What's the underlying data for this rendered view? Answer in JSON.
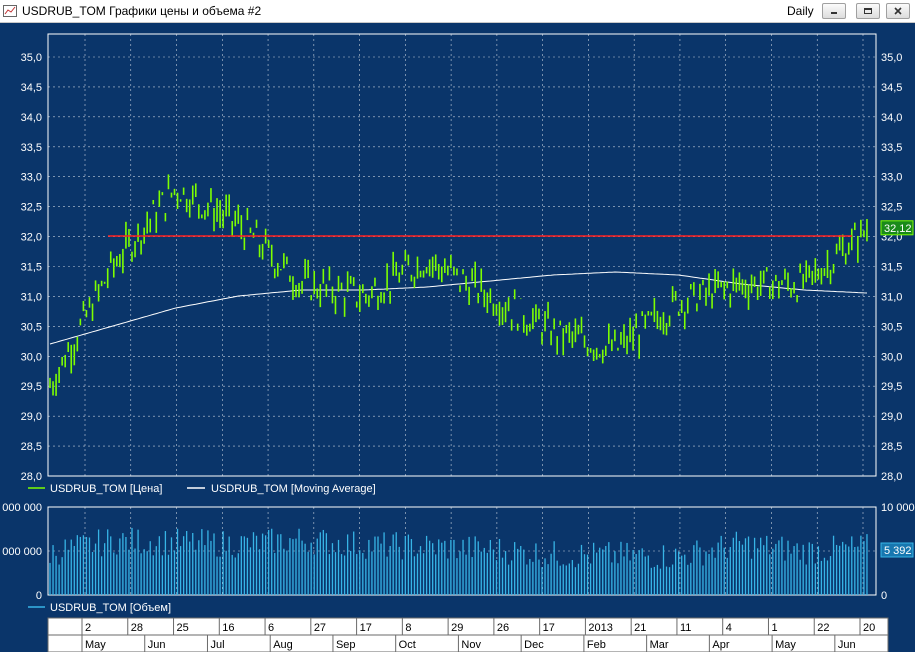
{
  "window": {
    "title": "USDRUB_TOM Графики цены и объема #2",
    "interval": "Daily",
    "icon": "chart-window-icon",
    "buttons": [
      "minimize-icon",
      "restore-icon",
      "close-icon"
    ]
  },
  "colors": {
    "background": "#0a356a",
    "price": "#7dff00",
    "moving_average": "#ffffff",
    "level_line": "#ff2020",
    "volume": "#37b4e6",
    "price_badge": "#1a8a1a",
    "volume_badge": "#1777b0"
  },
  "price_panel": {
    "y_ticks": [
      "35,0",
      "34,5",
      "34,0",
      "33,5",
      "33,0",
      "32,5",
      "32,0",
      "31,5",
      "31,0",
      "30,5",
      "30,0",
      "29,5",
      "29,0",
      "28,5",
      "28,0"
    ],
    "last_price": "32,12",
    "level": 32.0,
    "legend": [
      {
        "label": "USDRUB_TOM [Цена]",
        "icon": "green-line-icon"
      },
      {
        "label": "USDRUB_TOM [Moving Average]",
        "icon": "white-line-icon"
      }
    ]
  },
  "volume_panel": {
    "left_ticks": [
      "000 000",
      "000 000",
      "0"
    ],
    "right_ticks": [
      "10 000",
      "5 000",
      "0"
    ],
    "last_volume": "5 392",
    "legend": [
      {
        "label": "USDRUB_TOM [Объем]",
        "icon": "cyan-line-icon"
      }
    ]
  },
  "time_axis": {
    "days": [
      "2",
      "28",
      "25",
      "16",
      "6",
      "27",
      "17",
      "8",
      "29",
      "26",
      "17",
      "2013",
      "21",
      "11",
      "4",
      "1",
      "22",
      "20"
    ],
    "months": [
      "May",
      "Jun",
      "Jul",
      "Aug",
      "Sep",
      "Oct",
      "Nov",
      "Dec",
      "Feb",
      "Mar",
      "Apr",
      "May",
      "Jun"
    ]
  },
  "chart_data": {
    "type": "line",
    "title": "USDRUB_TOM Графики цены и объема #2",
    "y_range": [
      28.0,
      35.0
    ],
    "series": [
      {
        "name": "USDRUB_TOM [Цена]",
        "x": [
          "May",
          "Jun",
          "Jul",
          "Aug",
          "Sep",
          "Oct",
          "Nov",
          "Dec",
          "2013",
          "Feb",
          "Mar",
          "Apr",
          "May",
          "Jun"
        ],
        "values": [
          29.5,
          31.5,
          32.8,
          32.2,
          31.2,
          31.0,
          31.6,
          31.0,
          30.4,
          30.1,
          30.9,
          31.2,
          31.2,
          32.1
        ]
      },
      {
        "name": "USDRUB_TOM [Moving Average]",
        "x": [
          "May",
          "Jun",
          "Jul",
          "Aug",
          "Sep",
          "Oct",
          "Nov",
          "Dec",
          "2013",
          "Feb",
          "Mar",
          "Apr",
          "May",
          "Jun"
        ],
        "values": [
          30.2,
          30.5,
          30.8,
          31.0,
          31.1,
          31.1,
          31.15,
          31.25,
          31.35,
          31.4,
          31.35,
          31.2,
          31.1,
          31.05
        ]
      },
      {
        "name": "USDRUB_TOM [Объем]",
        "x": [
          "May",
          "Jun",
          "Jul",
          "Aug",
          "Sep",
          "Oct",
          "Nov",
          "Dec",
          "2013",
          "Feb",
          "Mar",
          "Apr",
          "May",
          "Jun"
        ],
        "values": [
          4800,
          6200,
          6000,
          5800,
          6300,
          5700,
          5500,
          5200,
          4600,
          4500,
          4400,
          5800,
          5000,
          5392
        ]
      }
    ]
  }
}
